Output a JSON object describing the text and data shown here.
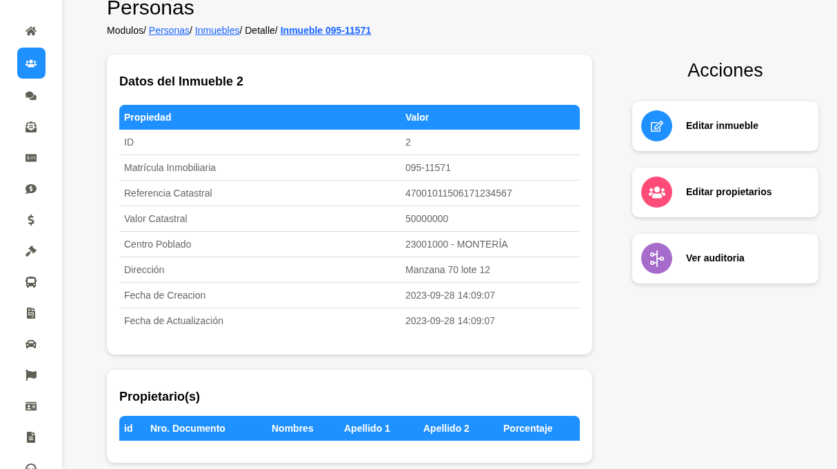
{
  "sidebar": {
    "items": [
      {
        "selected": false
      },
      {
        "selected": true
      },
      {
        "selected": false
      },
      {
        "selected": false
      },
      {
        "selected": false
      },
      {
        "selected": false
      },
      {
        "selected": false
      },
      {
        "selected": false
      },
      {
        "selected": false
      },
      {
        "selected": false
      },
      {
        "selected": false
      },
      {
        "selected": false
      },
      {
        "selected": false
      },
      {
        "selected": false
      },
      {
        "selected": false
      }
    ]
  },
  "page_title": "Personas",
  "breadcrumb": [
    {
      "text": "Modulos/",
      "kind": "plain"
    },
    {
      "text": "Personas",
      "kind": "link"
    },
    {
      "text": "/",
      "kind": "plain"
    },
    {
      "text": "Inmuebles",
      "kind": "link"
    },
    {
      "text": "/ Detalle/",
      "kind": "plain"
    },
    {
      "text": "Inmueble 095-11571",
      "kind": "current"
    }
  ],
  "details_card": {
    "title": "Datos del Inmueble 2",
    "columns": [
      "Propiedad",
      "Valor"
    ],
    "rows": [
      [
        "ID",
        "2"
      ],
      [
        "Matrícula Inmobiliaria",
        "095-11571"
      ],
      [
        "Referencia Catastral",
        "47001011506171234567"
      ],
      [
        "Valor Catastral",
        "50000000"
      ],
      [
        "Centro Poblado",
        "23001000 - MONTERÍA"
      ],
      [
        "Dirección",
        "Manzana 70 lote 12"
      ],
      [
        "Fecha de Creacion",
        "2023-09-28 14:09:07"
      ],
      [
        "Fecha de Actualización",
        "2023-09-28 14:09:07"
      ]
    ]
  },
  "owners_card": {
    "title": "Propietario(s)",
    "columns": [
      "id",
      "Nro. Documento",
      "Nombres",
      "Apellido 1",
      "Apellido 2",
      "Porcentaje"
    ]
  },
  "actions": {
    "title": "Acciones",
    "items": [
      {
        "label": "Editar inmueble",
        "kind": "edit",
        "color": "#1e90ff"
      },
      {
        "label": "Editar propietarios",
        "kind": "people",
        "color": "#ff4b77"
      },
      {
        "label": "Ver auditoria",
        "kind": "timeline",
        "color": "#a66bcb"
      }
    ]
  }
}
